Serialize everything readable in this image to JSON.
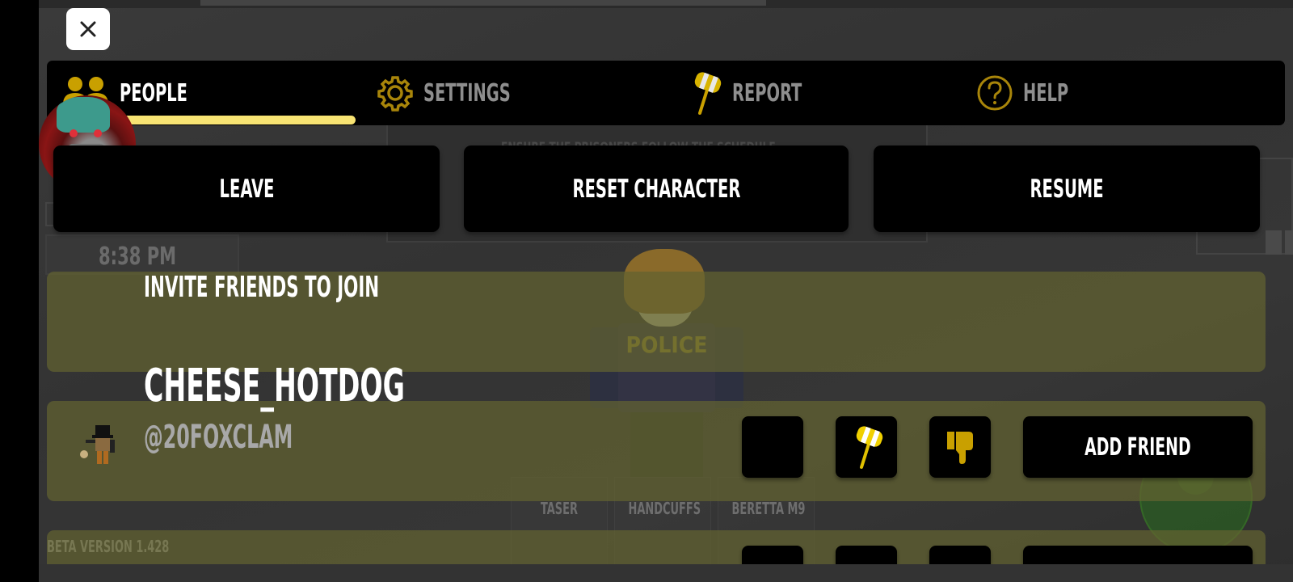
{
  "close_button": {
    "icon": "close-icon"
  },
  "tabs": [
    {
      "label": "PEOPLE",
      "icon": "people-icon",
      "active": true
    },
    {
      "label": "SETTINGS",
      "icon": "gear-icon",
      "active": false
    },
    {
      "label": "REPORT",
      "icon": "gavel-icon",
      "active": false
    },
    {
      "label": "HELP",
      "icon": "help-icon",
      "active": false
    }
  ],
  "actions": {
    "leave": "LEAVE",
    "reset": "RESET CHARACTER",
    "resume": "RESUME"
  },
  "invite": {
    "label": "INVITE FRIENDS TO JOIN"
  },
  "players": [
    {
      "display_name": "CHEESE_HOTDOG",
      "username": "@20FOXCLAM",
      "add_friend_label": "ADD FRIEND"
    }
  ],
  "game_hud": {
    "clock": "8:38 PM",
    "board_text": "ENSURE THE PRISONERS FOLLOW THE SCHEDULE",
    "character_shirt": "POLICE",
    "hotbar": [
      "TASER",
      "HANDCUFFS",
      "BERETTA M9"
    ],
    "version": "BETA VERSION 1.428"
  },
  "colors": {
    "accent_yellow": "#f8e473",
    "icon_gold": "#c9a000",
    "row_olive": "#5e5e34",
    "panel_black": "#000000"
  }
}
